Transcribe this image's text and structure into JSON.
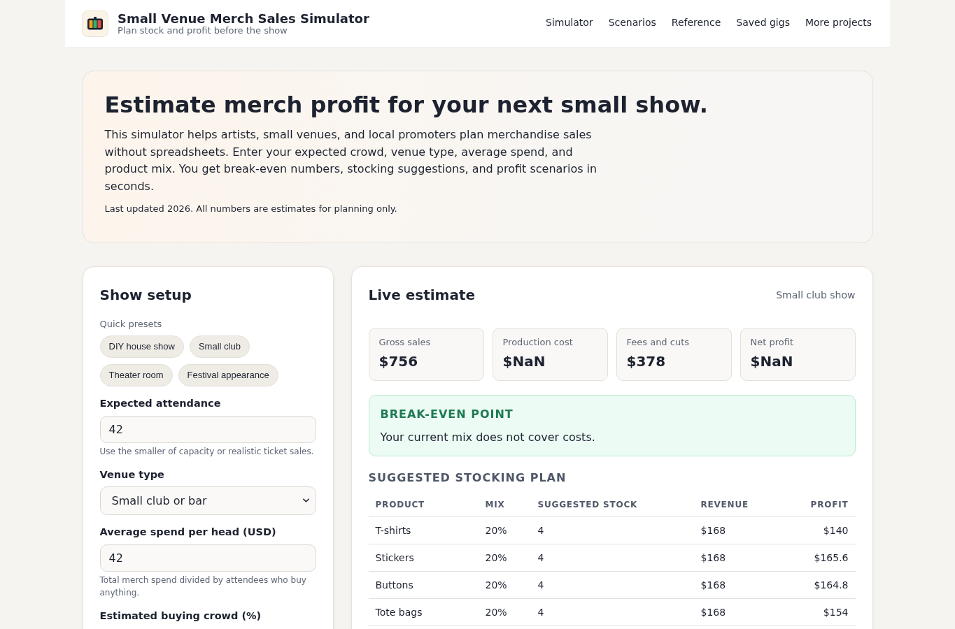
{
  "header": {
    "title": "Small Venue Merch Sales Simulator",
    "subtitle": "Plan stock and profit before the show",
    "nav": [
      "Simulator",
      "Scenarios",
      "Reference",
      "Saved gigs",
      "More projects"
    ]
  },
  "hero": {
    "title": "Estimate merch profit for your next small show.",
    "description": "This simulator helps artists, small venues, and local promoters plan merchandise sales without spreadsheets. Enter your expected crowd, venue type, average spend, and product mix. You get break-even numbers, stocking suggestions, and profit scenarios in seconds.",
    "note": "Last updated 2026. All numbers are estimates for planning only."
  },
  "setup": {
    "title": "Show setup",
    "presets_label": "Quick presets",
    "presets": [
      "DIY house show",
      "Small club",
      "Theater room",
      "Festival appearance"
    ],
    "fields": [
      {
        "kind": "input",
        "label": "Expected attendance",
        "value": "42",
        "hint": "Use the smaller of capacity or realistic ticket sales."
      },
      {
        "kind": "select",
        "label": "Venue type",
        "value": "Small club or bar"
      },
      {
        "kind": "input",
        "label": "Average spend per head (USD)",
        "value": "42",
        "hint": "Total merch spend divided by attendees who buy anything."
      },
      {
        "kind": "label",
        "label": "Estimated buying crowd (%)"
      }
    ]
  },
  "estimate": {
    "title": "Live estimate",
    "scenario": "Small club show",
    "stats": [
      {
        "label": "Gross sales",
        "value": "$756"
      },
      {
        "label": "Production cost",
        "value": "$NaN"
      },
      {
        "label": "Fees and cuts",
        "value": "$378"
      },
      {
        "label": "Net profit",
        "value": "$NaN"
      }
    ],
    "break_even": {
      "title": "BREAK-EVEN POINT",
      "message": "Your current mix does not cover costs."
    },
    "stocking_plan": {
      "title": "SUGGESTED STOCKING PLAN",
      "columns": [
        "PRODUCT",
        "MIX",
        "SUGGESTED STOCK",
        "REVENUE",
        "PROFIT"
      ],
      "rows": [
        [
          "T-shirts",
          "20%",
          "4",
          "$168",
          "$140"
        ],
        [
          "Stickers",
          "20%",
          "4",
          "$168",
          "$165.6"
        ],
        [
          "Buttons",
          "20%",
          "4",
          "$168",
          "$164.8"
        ],
        [
          "Tote bags",
          "20%",
          "4",
          "$168",
          "$154"
        ]
      ]
    }
  }
}
